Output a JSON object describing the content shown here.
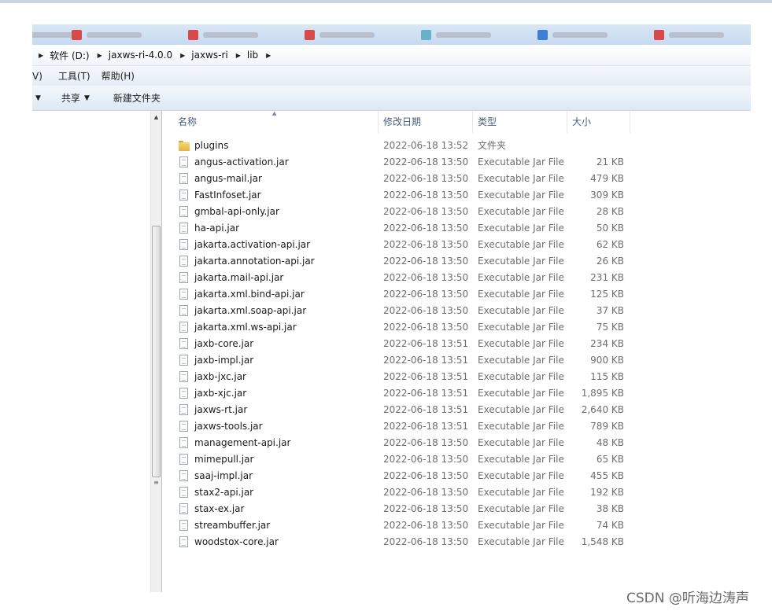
{
  "address": {
    "crumbs": [
      "软件 (D:)",
      "jaxws-ri-4.0.0",
      "jaxws-ri",
      "lib"
    ]
  },
  "menu": {
    "view_partial": "V)",
    "tools": "工具(T)",
    "help": "帮助(H)"
  },
  "toolbar": {
    "share": "共享",
    "new_folder": "新建文件夹"
  },
  "columns": {
    "name": "名称",
    "date": "修改日期",
    "type": "类型",
    "size": "大小"
  },
  "files": [
    {
      "name": "plugins",
      "date": "2022-06-18 13:52",
      "type": "文件夹",
      "size": "",
      "icon": "folder-icon"
    },
    {
      "name": "angus-activation.jar",
      "date": "2022-06-18 13:50",
      "type": "Executable Jar File",
      "size": "21 KB",
      "icon": "jar-file-icon"
    },
    {
      "name": "angus-mail.jar",
      "date": "2022-06-18 13:50",
      "type": "Executable Jar File",
      "size": "479 KB",
      "icon": "jar-file-icon"
    },
    {
      "name": "FastInfoset.jar",
      "date": "2022-06-18 13:50",
      "type": "Executable Jar File",
      "size": "309 KB",
      "icon": "jar-file-icon"
    },
    {
      "name": "gmbal-api-only.jar",
      "date": "2022-06-18 13:50",
      "type": "Executable Jar File",
      "size": "28 KB",
      "icon": "jar-file-icon"
    },
    {
      "name": "ha-api.jar",
      "date": "2022-06-18 13:50",
      "type": "Executable Jar File",
      "size": "50 KB",
      "icon": "jar-file-icon"
    },
    {
      "name": "jakarta.activation-api.jar",
      "date": "2022-06-18 13:50",
      "type": "Executable Jar File",
      "size": "62 KB",
      "icon": "jar-file-icon"
    },
    {
      "name": "jakarta.annotation-api.jar",
      "date": "2022-06-18 13:50",
      "type": "Executable Jar File",
      "size": "26 KB",
      "icon": "jar-file-icon"
    },
    {
      "name": "jakarta.mail-api.jar",
      "date": "2022-06-18 13:50",
      "type": "Executable Jar File",
      "size": "231 KB",
      "icon": "jar-file-icon"
    },
    {
      "name": "jakarta.xml.bind-api.jar",
      "date": "2022-06-18 13:50",
      "type": "Executable Jar File",
      "size": "125 KB",
      "icon": "jar-file-icon"
    },
    {
      "name": "jakarta.xml.soap-api.jar",
      "date": "2022-06-18 13:50",
      "type": "Executable Jar File",
      "size": "37 KB",
      "icon": "jar-file-icon"
    },
    {
      "name": "jakarta.xml.ws-api.jar",
      "date": "2022-06-18 13:50",
      "type": "Executable Jar File",
      "size": "75 KB",
      "icon": "jar-file-icon"
    },
    {
      "name": "jaxb-core.jar",
      "date": "2022-06-18 13:51",
      "type": "Executable Jar File",
      "size": "234 KB",
      "icon": "jar-file-icon"
    },
    {
      "name": "jaxb-impl.jar",
      "date": "2022-06-18 13:51",
      "type": "Executable Jar File",
      "size": "900 KB",
      "icon": "jar-file-icon"
    },
    {
      "name": "jaxb-jxc.jar",
      "date": "2022-06-18 13:51",
      "type": "Executable Jar File",
      "size": "115 KB",
      "icon": "jar-file-icon"
    },
    {
      "name": "jaxb-xjc.jar",
      "date": "2022-06-18 13:51",
      "type": "Executable Jar File",
      "size": "1,895 KB",
      "icon": "jar-file-icon"
    },
    {
      "name": "jaxws-rt.jar",
      "date": "2022-06-18 13:51",
      "type": "Executable Jar File",
      "size": "2,640 KB",
      "icon": "jar-file-icon"
    },
    {
      "name": "jaxws-tools.jar",
      "date": "2022-06-18 13:51",
      "type": "Executable Jar File",
      "size": "789 KB",
      "icon": "jar-file-icon"
    },
    {
      "name": "management-api.jar",
      "date": "2022-06-18 13:50",
      "type": "Executable Jar File",
      "size": "48 KB",
      "icon": "jar-file-icon"
    },
    {
      "name": "mimepull.jar",
      "date": "2022-06-18 13:50",
      "type": "Executable Jar File",
      "size": "65 KB",
      "icon": "jar-file-icon"
    },
    {
      "name": "saaj-impl.jar",
      "date": "2022-06-18 13:50",
      "type": "Executable Jar File",
      "size": "455 KB",
      "icon": "jar-file-icon"
    },
    {
      "name": "stax2-api.jar",
      "date": "2022-06-18 13:50",
      "type": "Executable Jar File",
      "size": "192 KB",
      "icon": "jar-file-icon"
    },
    {
      "name": "stax-ex.jar",
      "date": "2022-06-18 13:50",
      "type": "Executable Jar File",
      "size": "38 KB",
      "icon": "jar-file-icon"
    },
    {
      "name": "streambuffer.jar",
      "date": "2022-06-18 13:50",
      "type": "Executable Jar File",
      "size": "74 KB",
      "icon": "jar-file-icon"
    },
    {
      "name": "woodstox-core.jar",
      "date": "2022-06-18 13:50",
      "type": "Executable Jar File",
      "size": "1,548 KB",
      "icon": "jar-file-icon"
    }
  ],
  "watermark": "CSDN @听海边涛声"
}
